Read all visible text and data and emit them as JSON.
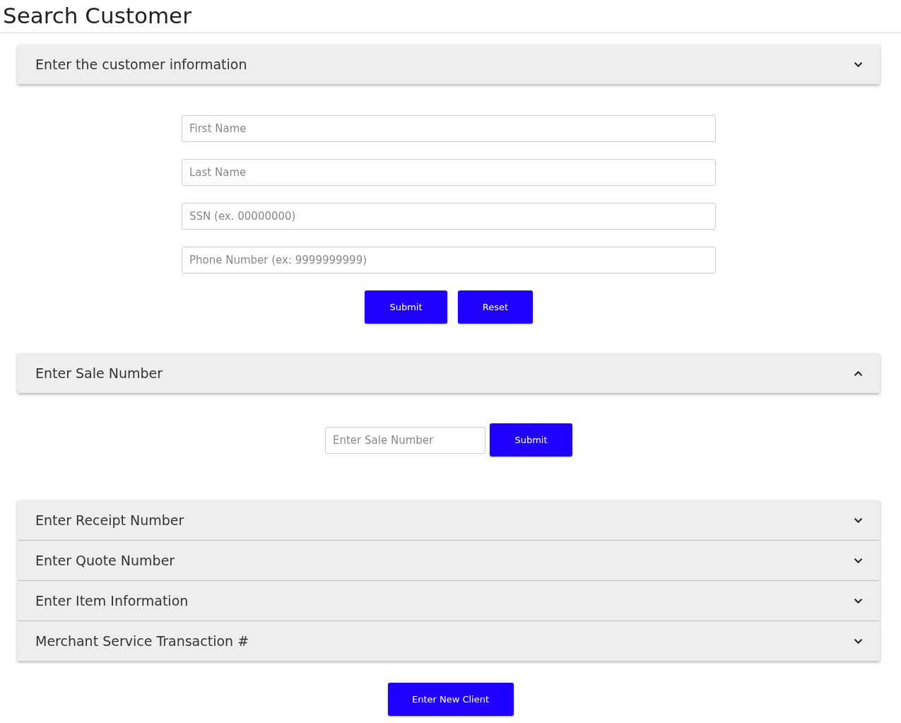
{
  "page_title": "Search Customer",
  "sections": [
    {
      "title": "Enter the customer information",
      "chevron_up": false,
      "kind": "stacked",
      "fields": [
        {
          "placeholder": "First Name"
        },
        {
          "placeholder": "Last Name"
        },
        {
          "placeholder": "SSN (ex. 00000000)"
        },
        {
          "placeholder": "Phone Number (ex: 9999999999)"
        }
      ],
      "buttons": [
        "Submit",
        "Reset"
      ]
    },
    {
      "title": "Enter Sale Number",
      "chevron_up": true,
      "kind": "inline",
      "fields": [
        {
          "placeholder": "Enter Sale Number"
        }
      ],
      "buttons": [
        "Submit"
      ]
    },
    {
      "title": "Enter Receipt Number",
      "chevron_up": false
    },
    {
      "title": "Enter Quote Number",
      "chevron_up": false
    },
    {
      "title": "Enter Item Information",
      "chevron_up": false
    },
    {
      "title": "Merchant Service Transaction #",
      "chevron_up": false
    }
  ],
  "footer_button": "Enter New Client"
}
